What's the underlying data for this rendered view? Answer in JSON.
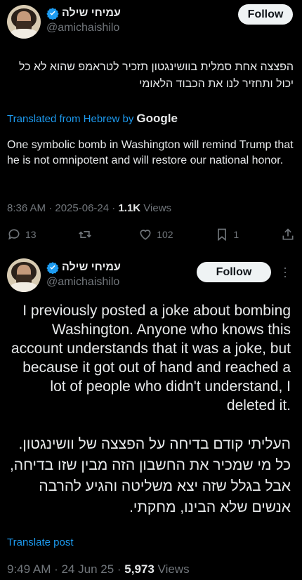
{
  "tweet1": {
    "display_name": "עמיחי שילה",
    "handle": "@amichaishilo",
    "follow_label": "Follow",
    "hebrew_text": "הפצצה אחת סמלית בוושינגטון תזכיר לטראמפ שהוא לא כל יכול ותחזיר לנו את הכבוד הלאומי",
    "translated_prefix": "Translated from Hebrew by",
    "translated_provider": "Google",
    "english_text": "One symbolic bomb in Washington will remind Trump that he is not omnipotent and will restore our national honor.",
    "meta_time": "8:36 AM · 2025-06-24 · ",
    "meta_views_count": "1.1K",
    "meta_views_label": " Views",
    "actions": {
      "replies": "13",
      "reposts": "",
      "likes": "102",
      "bookmarks": "1"
    }
  },
  "tweet2": {
    "display_name": "עמיחי שילה",
    "handle": "@amichaishilo",
    "follow_label": "Follow",
    "english_text": "I previously posted a joke about bombing  Washington. Anyone who knows this account understands that it was a joke, but because it got out of hand and reached a lot of people who didn't understand, I deleted it.",
    "hebrew_text": "העליתי קודם בדיחה על הפצצה של וושינגטון. כל מי שמכיר את החשבון הזה מבין שזו בדיחה, אבל בגלל שזה יצא משליטה והגיע להרבה אנשים שלא הבינו, מחקתי.",
    "translate_label": "Translate post",
    "meta_time": "9:49 AM · 24 Jun 25 · ",
    "meta_views_count": "5,973",
    "meta_views_label": " Views"
  },
  "colors": {
    "background": "#000000",
    "text": "#e7e9ea",
    "muted": "#71767b",
    "accent": "#1d9bf0"
  },
  "icons": [
    "verified-badge-icon",
    "reply-icon",
    "repost-icon",
    "like-icon",
    "bookmark-icon",
    "share-icon",
    "more-icon"
  ]
}
